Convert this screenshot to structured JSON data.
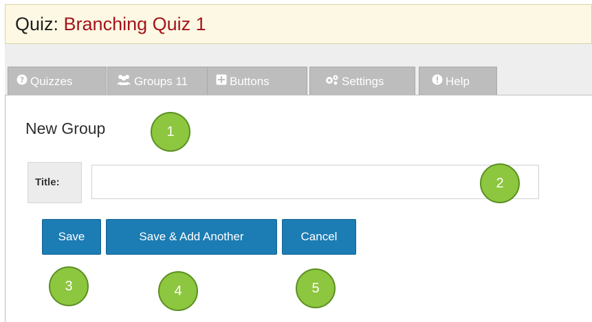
{
  "header": {
    "prefix": "Quiz: ",
    "quiz_name": "Branching Quiz 1"
  },
  "tabs": [
    {
      "label": "Quizzes",
      "icon": "question-circle-icon"
    },
    {
      "label": "Groups 11",
      "icon": "users-icon"
    },
    {
      "label": "Buttons",
      "icon": "plus-square-icon"
    },
    {
      "label": "Settings",
      "icon": "gears-icon"
    },
    {
      "label": "Help",
      "icon": "info-circle-icon"
    }
  ],
  "form": {
    "heading": "New Group",
    "title_label": "Title:",
    "title_value": ""
  },
  "buttons": {
    "save": "Save",
    "save_add": "Save & Add Another",
    "cancel": "Cancel"
  },
  "callouts": [
    "1",
    "2",
    "3",
    "4",
    "5"
  ],
  "colors": {
    "header_bg": "#fcf8e3",
    "quiz_name": "#a4141b",
    "button": "#1c7cb4",
    "callout": "#8dc63f",
    "tab": "#bdbdbd"
  }
}
